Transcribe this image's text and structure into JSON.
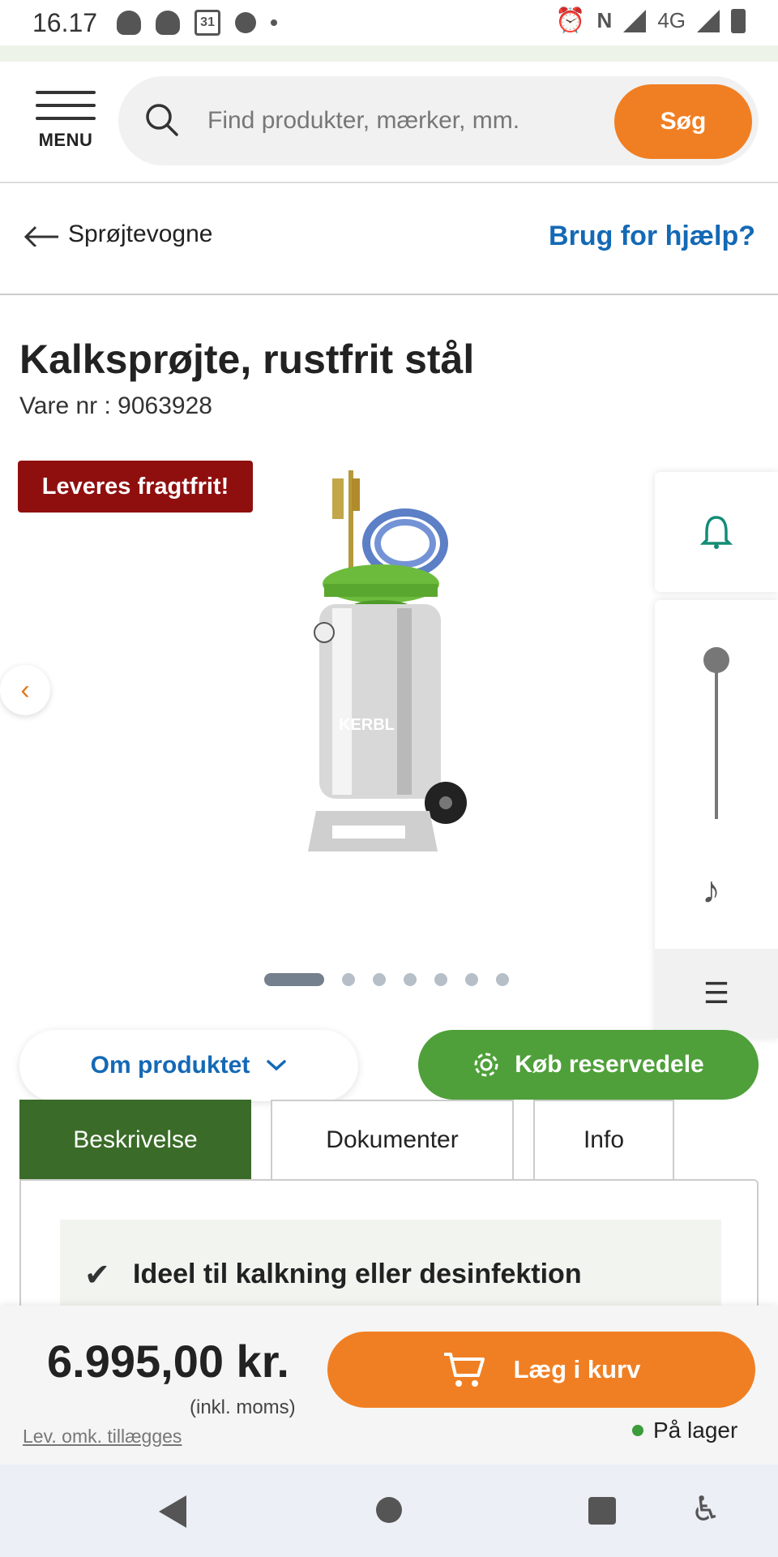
{
  "status_bar": {
    "time": "16.17",
    "calendar_day": "31",
    "network": "4G"
  },
  "header": {
    "menu_label": "MENU",
    "search_placeholder": "Find produkter, mærker, mm.",
    "search_button": "Søg"
  },
  "breadcrumb": {
    "back_label": "Sprøjtevogne",
    "help_link": "Brug for hjælp?"
  },
  "product": {
    "title": "Kalksprøjte, rustfrit stål",
    "sku": "Vare nr : 9063928",
    "badge": "Leveres fragtfrit!",
    "image_brand": "KERBL",
    "carousel_total": 7,
    "carousel_active": 1
  },
  "actions": {
    "about_button": "Om produktet",
    "spare_parts_button": "Køb reservedele"
  },
  "tabs": [
    {
      "label": "Beskrivelse",
      "active": true
    },
    {
      "label": "Dokumenter",
      "active": false
    },
    {
      "label": "Info",
      "active": false
    }
  ],
  "description": {
    "feature": "Ideel til kalkning eller desinfektion"
  },
  "purchase": {
    "price": "6.995,00 kr.",
    "vat_note": "(inkl. moms)",
    "delivery_note": "Lev. omk. tillægges",
    "add_to_cart": "Læg i kurv",
    "stock_status": "På lager"
  },
  "colors": {
    "accent_orange": "#f07f23",
    "green_button": "#4fa03a",
    "dark_green_tab": "#3a6b28",
    "badge_red": "#8f0f0f",
    "link_blue": "#1469b5"
  }
}
